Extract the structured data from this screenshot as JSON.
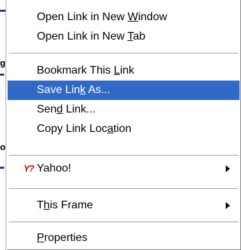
{
  "menu": {
    "items": [
      {
        "id": "open-new-window",
        "pre": "Open Link in New ",
        "acc": "W",
        "post": "indow",
        "highlighted": false,
        "submenu": false
      },
      {
        "id": "open-new-tab",
        "pre": "Open Link in New ",
        "acc": "T",
        "post": "ab",
        "highlighted": false,
        "submenu": false
      },
      {
        "id": "bookmark-link",
        "pre": "Bookmark This ",
        "acc": "L",
        "post": "ink",
        "highlighted": false,
        "submenu": false
      },
      {
        "id": "save-link-as",
        "pre": "Save Lin",
        "acc": "k",
        "post": " As...",
        "highlighted": true,
        "submenu": false
      },
      {
        "id": "send-link",
        "pre": "Sen",
        "acc": "d",
        "post": " Link...",
        "highlighted": false,
        "submenu": false
      },
      {
        "id": "copy-link-location",
        "pre": "Copy Link Loc",
        "acc": "a",
        "post": "tion",
        "highlighted": false,
        "submenu": false
      },
      {
        "id": "yahoo",
        "pre": "Yahoo!",
        "acc": "",
        "post": "",
        "highlighted": false,
        "submenu": true,
        "icon": "yahoo-icon",
        "icon_text": "Y?"
      },
      {
        "id": "this-frame",
        "pre": "T",
        "acc": "h",
        "post": "is Frame",
        "highlighted": false,
        "submenu": true
      },
      {
        "id": "properties",
        "pre": "",
        "acc": "P",
        "post": "roperties",
        "highlighted": false,
        "submenu": false
      }
    ]
  },
  "colors": {
    "highlight": "#316ac5",
    "background": "#ffffff",
    "yahoo_icon": "#d40000"
  }
}
